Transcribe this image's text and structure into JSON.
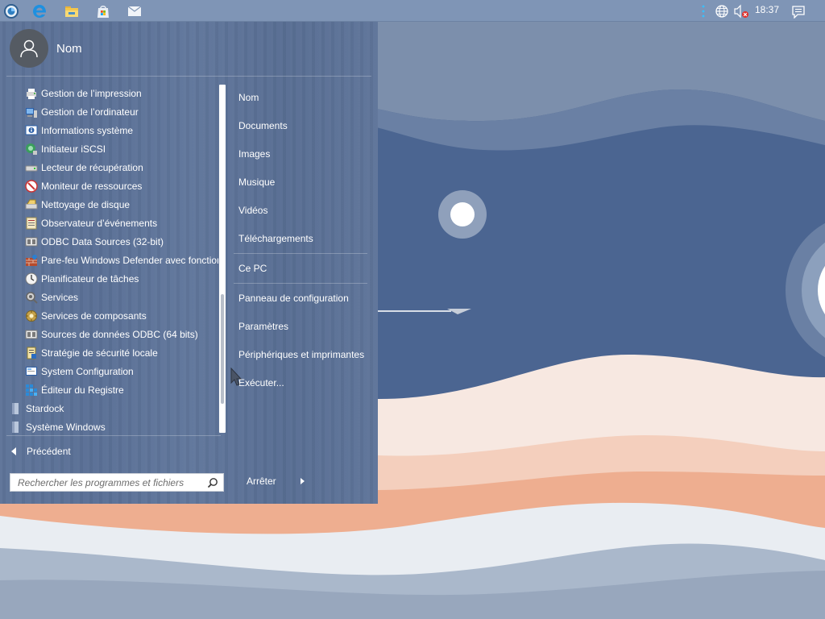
{
  "taskbar": {
    "clock": "18:37",
    "icons": [
      "start-orb-icon",
      "edge-icon",
      "file-explorer-icon",
      "store-icon",
      "mail-icon"
    ],
    "tray_icons": [
      "overflow-dots-icon",
      "network-globe-icon",
      "volume-muted-icon",
      "notifications-icon"
    ]
  },
  "start_menu": {
    "user_name": "Nom",
    "programs": [
      {
        "label": "Gestion de l’impression",
        "icon": "print-management-icon"
      },
      {
        "label": "Gestion de l’ordinateur",
        "icon": "computer-management-icon"
      },
      {
        "label": "Informations système",
        "icon": "system-information-icon"
      },
      {
        "label": "Initiateur iSCSI",
        "icon": "iscsi-initiator-icon"
      },
      {
        "label": "Lecteur de récupération",
        "icon": "recovery-drive-icon"
      },
      {
        "label": "Moniteur de ressources",
        "icon": "resource-monitor-icon"
      },
      {
        "label": "Nettoyage de disque",
        "icon": "disk-cleanup-icon"
      },
      {
        "label": "Observateur d’événements",
        "icon": "event-viewer-icon"
      },
      {
        "label": "ODBC Data Sources (32-bit)",
        "icon": "odbc-icon"
      },
      {
        "label": "Pare-feu Windows Defender avec fonction",
        "icon": "firewall-icon"
      },
      {
        "label": "Planificateur de tâches",
        "icon": "task-scheduler-icon"
      },
      {
        "label": "Services",
        "icon": "services-icon"
      },
      {
        "label": "Services de composants",
        "icon": "component-services-icon"
      },
      {
        "label": "Sources de données ODBC (64 bits)",
        "icon": "odbc-64-icon"
      },
      {
        "label": "Stratégie de sécurité locale",
        "icon": "security-policy-icon"
      },
      {
        "label": "System Configuration",
        "icon": "system-configuration-icon"
      },
      {
        "label": "Éditeur du Registre",
        "icon": "registry-editor-icon"
      }
    ],
    "folders": [
      {
        "label": "Stardock",
        "icon": "folder-icon"
      },
      {
        "label": "Système Windows",
        "icon": "folder-icon"
      }
    ],
    "back_label": "Précédent",
    "search_placeholder": "Rechercher les programmes et fichiers",
    "right_items": {
      "nom": "Nom",
      "documents": "Documents",
      "images": "Images",
      "musique": "Musique",
      "videos": "Vidéos",
      "telechargements": "Téléchargements",
      "ce_pc": "Ce PC",
      "panneau": "Panneau de configuration",
      "parametres": "Paramètres",
      "peripheriques": "Périphériques et imprimantes",
      "executer": "Exécuter..."
    },
    "shutdown_label": "Arrêter"
  },
  "colors": {
    "menu_bg": "#5e7499",
    "taskbar_bg": "#7f95b6",
    "sky": "#4d6690",
    "sand_light": "#f6e6de",
    "sand_mid": "#f3c9b3",
    "sand_dark": "#eeac8d"
  }
}
